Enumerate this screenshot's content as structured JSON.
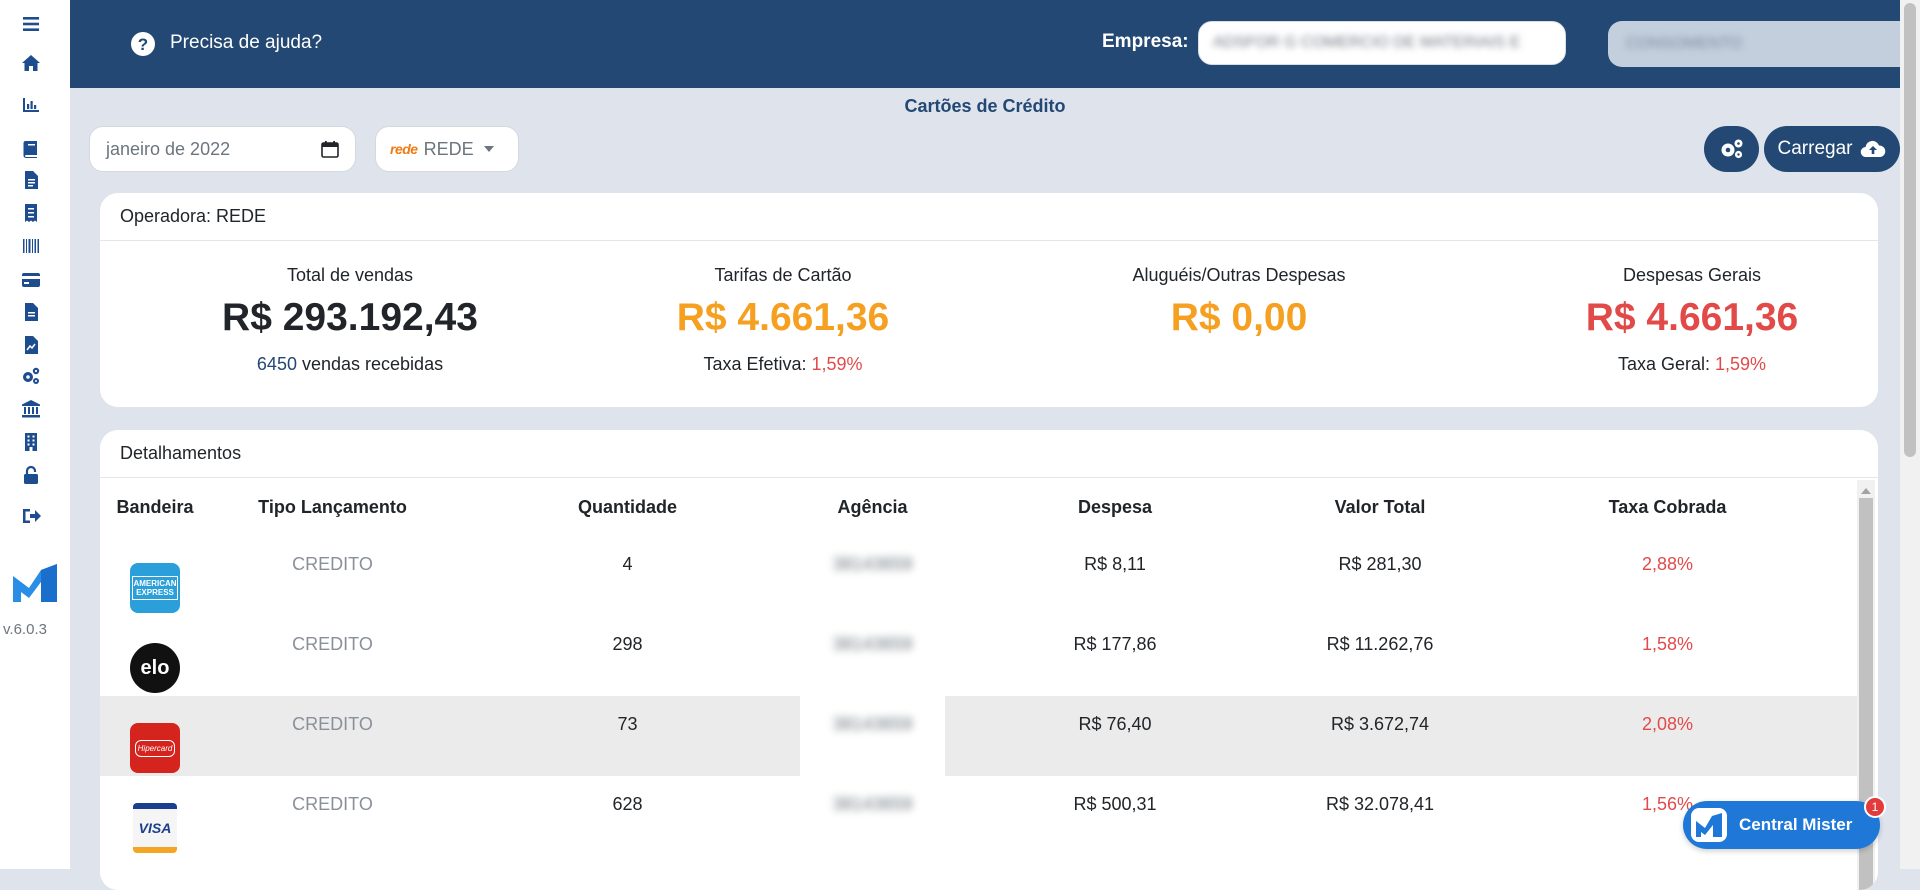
{
  "sidebar": {
    "items": [
      {
        "icon": "menu-icon"
      },
      {
        "icon": "home-icon"
      },
      {
        "icon": "chart-icon"
      },
      {
        "icon": "book-icon"
      },
      {
        "icon": "file-icon"
      },
      {
        "icon": "receipt-icon"
      },
      {
        "icon": "barcode-icon"
      },
      {
        "icon": "credit-card-icon"
      },
      {
        "icon": "document-icon"
      },
      {
        "icon": "file-signature-icon"
      },
      {
        "icon": "cogs-icon"
      },
      {
        "icon": "bank-icon"
      },
      {
        "icon": "building-icon"
      },
      {
        "icon": "unlock-icon"
      },
      {
        "icon": "sign-out-icon"
      }
    ],
    "version": "v.6.0.3"
  },
  "topbar": {
    "help_label": "Precisa de ajuda?",
    "company_label": "Empresa:",
    "company_value": "ADSFOR G COMERCIO DE MATERIAIS E",
    "company_select": "CONSOMENTO"
  },
  "page": {
    "title": "Cartões de Crédito",
    "month_value": "janeiro de 2022",
    "operator_logo": "rede",
    "operator_value": "REDE",
    "upload_label": "Carregar"
  },
  "summary": {
    "header": "Operadora: REDE",
    "total_sales_label": "Total de vendas",
    "total_sales_value": "R$ 293.192,43",
    "sales_count": "6450",
    "sales_count_suffix": "vendas recebidas",
    "card_fees_label": "Tarifas de Cartão",
    "card_fees_value": "R$ 4.661,36",
    "effective_rate_label": "Taxa Efetiva:",
    "effective_rate_value": "1,59%",
    "rentals_label": "Aluguéis/Outras Despesas",
    "rentals_value": "R$ 0,00",
    "general_label": "Despesas Gerais",
    "general_value": "R$ 4.661,36",
    "general_rate_label": "Taxa Geral:",
    "general_rate_value": "1,59%"
  },
  "details": {
    "header": "Detalhamentos",
    "columns": [
      "Bandeira",
      "Tipo Lançamento",
      "Quantidade",
      "Agência",
      "Despesa",
      "Valor Total",
      "Taxa Cobrada"
    ],
    "rows": [
      {
        "brand": "American Express",
        "brand_text": "AMERICAN EXPRESS",
        "type": "CREDITO",
        "qty": "4",
        "agency": "38143659",
        "expense": "R$ 8,11",
        "total": "R$ 281,30",
        "rate": "2,88%"
      },
      {
        "brand": "Elo",
        "brand_text": "elo",
        "type": "CREDITO",
        "qty": "298",
        "agency": "38143659",
        "expense": "R$ 177,86",
        "total": "R$ 11.262,76",
        "rate": "1,58%"
      },
      {
        "brand": "Hipercard",
        "brand_text": "Hipercard",
        "type": "CREDITO",
        "qty": "73",
        "agency": "38143659",
        "expense": "R$ 76,40",
        "total": "R$ 3.672,74",
        "rate": "2,08%"
      },
      {
        "brand": "Visa",
        "brand_text": "VISA",
        "type": "CREDITO",
        "qty": "628",
        "agency": "38143659",
        "expense": "R$ 500,31",
        "total": "R$ 32.078,41",
        "rate": "1,56%"
      }
    ]
  },
  "chat": {
    "label": "Central Mister",
    "badge": "1"
  },
  "colors": {
    "primary": "#224873",
    "orange": "#f5a021",
    "red": "#e24a4a",
    "chat_blue": "#1f78d8"
  }
}
